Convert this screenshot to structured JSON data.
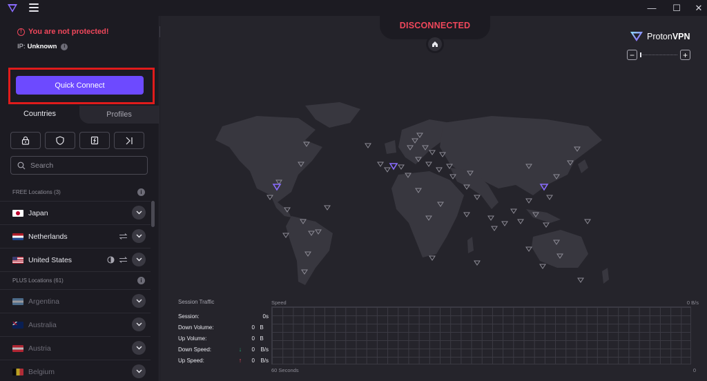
{
  "window": {
    "minimize": "—",
    "maximize": "☐",
    "close": "✕"
  },
  "sidebar": {
    "status_text": "You are not protected!",
    "ip_label": "IP:",
    "ip_value": "Unknown",
    "quick_connect_label": "Quick Connect",
    "tabs": [
      {
        "label": "Countries"
      },
      {
        "label": "Profiles"
      }
    ],
    "filters": [
      "lock-icon",
      "shield-icon",
      "p2p-icon",
      "tor-icon"
    ],
    "search_placeholder": "Search",
    "free_section": "FREE Locations (3)",
    "plus_section": "PLUS Locations (61)",
    "free_countries": [
      {
        "name": "Japan",
        "flag": "JP"
      },
      {
        "name": "Netherlands",
        "flag": "NL"
      },
      {
        "name": "United States",
        "flag": "US"
      }
    ],
    "plus_countries": [
      {
        "name": "Argentina",
        "flag": "AR"
      },
      {
        "name": "Australia",
        "flag": "AU"
      },
      {
        "name": "Austria",
        "flag": "AT"
      },
      {
        "name": "Belgium",
        "flag": "BE"
      }
    ]
  },
  "main": {
    "connection_state": "DISCONNECTED",
    "brand_part1": "Proton",
    "brand_part2": "VPN",
    "zoom_minus": "−",
    "zoom_plus": "+",
    "traffic": {
      "title": "Session Traffic",
      "session_label": "Session:",
      "session_value": "0s",
      "down_volume_label": "Down Volume:",
      "down_volume_value": "0",
      "down_volume_unit": "B",
      "up_volume_label": "Up Volume:",
      "up_volume_value": "0",
      "up_volume_unit": "B",
      "down_speed_label": "Down Speed:",
      "down_speed_value": "0",
      "down_speed_unit": "B/s",
      "up_speed_label": "Up Speed:",
      "up_speed_value": "0",
      "up_speed_unit": "B/s"
    },
    "speed_label": "Speed",
    "speed_max": "0 B/s",
    "speed_min": "0",
    "seconds_label": "60 Seconds"
  },
  "colors": {
    "accent": "#6d4aff",
    "danger": "#f0475b",
    "background": "#25242b",
    "sidebar": "#1c1b22"
  }
}
